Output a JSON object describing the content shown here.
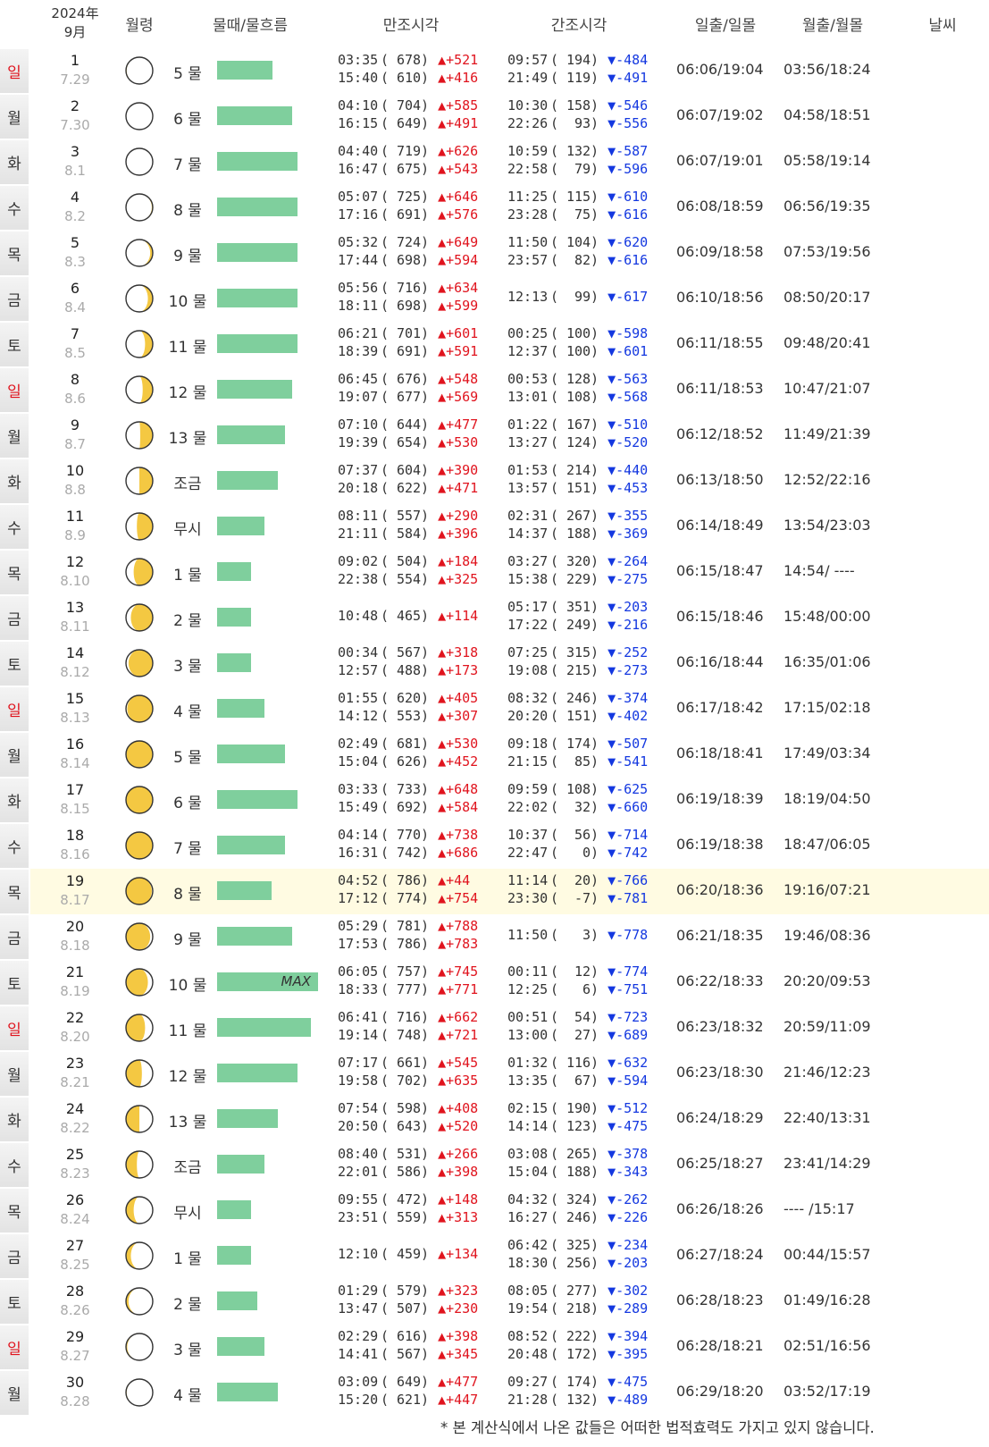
{
  "header": {
    "year": "2024年",
    "month": "9月",
    "moon_age": "월령",
    "mulddae": "물때/물흐름",
    "high_tide": "만조시각",
    "low_tide": "간조시각",
    "sun": "일출/일몰",
    "moon": "월출/월몰",
    "weather": "날씨"
  },
  "max_label": "MAX",
  "footnote": "* 본 계산식에서 나온 값들은 어떠한 법적효력도 가지고 있지 않습니다.",
  "colors": {
    "sunday": "#e0141e",
    "up": "#e0141e",
    "down": "#1438e0",
    "bar": "#7fcf9d",
    "highlight": "#fffbe2",
    "moon_lit": "#f4c842"
  },
  "days": [
    {
      "d": "1",
      "lunar": "7.29",
      "dow": "일",
      "sun_day": true,
      "phase": 0.95,
      "mul": "5 물",
      "flow": 0.55,
      "high": [
        [
          "03:35",
          "678",
          "▲+521"
        ],
        [
          "15:40",
          "610",
          "▲+416"
        ]
      ],
      "low": [
        [
          "09:57",
          "194",
          "▼-484"
        ],
        [
          "21:49",
          "119",
          "▼-491"
        ]
      ],
      "sun": "06:06/19:04",
      "moon": "03:56/18:24"
    },
    {
      "d": "2",
      "lunar": "7.30",
      "dow": "월",
      "phase": 1.0,
      "mul": "6 물",
      "flow": 0.74,
      "high": [
        [
          "04:10",
          "704",
          "▲+585"
        ],
        [
          "16:15",
          "649",
          "▲+491"
        ]
      ],
      "low": [
        [
          "10:30",
          "158",
          "▼-546"
        ],
        [
          "22:26",
          " 93",
          "▼-556"
        ]
      ],
      "sun": "06:07/19:02",
      "moon": "04:58/18:51"
    },
    {
      "d": "3",
      "lunar": "8.1",
      "dow": "화",
      "phase": 0.03,
      "mul": "7 물",
      "flow": 0.8,
      "high": [
        [
          "04:40",
          "719",
          "▲+626"
        ],
        [
          "16:47",
          "675",
          "▲+543"
        ]
      ],
      "low": [
        [
          "10:59",
          "132",
          "▼-587"
        ],
        [
          "22:58",
          " 79",
          "▼-596"
        ]
      ],
      "sun": "06:07/19:01",
      "moon": "05:58/19:14"
    },
    {
      "d": "4",
      "lunar": "8.2",
      "dow": "수",
      "phase": 0.06,
      "mul": "8 물",
      "flow": 0.8,
      "high": [
        [
          "05:07",
          "725",
          "▲+646"
        ],
        [
          "17:16",
          "691",
          "▲+576"
        ]
      ],
      "low": [
        [
          "11:25",
          "115",
          "▼-610"
        ],
        [
          "23:28",
          " 75",
          "▼-616"
        ]
      ],
      "sun": "06:08/18:59",
      "moon": "06:56/19:35"
    },
    {
      "d": "5",
      "lunar": "8.3",
      "dow": "목",
      "phase": 0.1,
      "mul": "9 물",
      "flow": 0.8,
      "high": [
        [
          "05:32",
          "724",
          "▲+649"
        ],
        [
          "17:44",
          "698",
          "▲+594"
        ]
      ],
      "low": [
        [
          "11:50",
          "104",
          "▼-620"
        ],
        [
          "23:57",
          " 82",
          "▼-616"
        ]
      ],
      "sun": "06:09/18:58",
      "moon": "07:53/19:56"
    },
    {
      "d": "6",
      "lunar": "8.4",
      "dow": "금",
      "phase": 0.14,
      "mul": "10 물",
      "flow": 0.8,
      "high": [
        [
          "05:56",
          "716",
          "▲+634"
        ],
        [
          "18:11",
          "698",
          "▲+599"
        ]
      ],
      "low": [
        [
          "12:13",
          " 99",
          "▼-617"
        ]
      ],
      "sun": "06:10/18:56",
      "moon": "08:50/20:17"
    },
    {
      "d": "7",
      "lunar": "8.5",
      "dow": "토",
      "phase": 0.18,
      "mul": "11 물",
      "flow": 0.8,
      "high": [
        [
          "06:21",
          "701",
          "▲+601"
        ],
        [
          "18:39",
          "691",
          "▲+591"
        ]
      ],
      "low": [
        [
          "00:25",
          "100",
          "▼-598"
        ],
        [
          "12:37",
          "100",
          "▼-601"
        ]
      ],
      "sun": "06:11/18:55",
      "moon": "09:48/20:41"
    },
    {
      "d": "8",
      "lunar": "8.6",
      "dow": "일",
      "sun_day": true,
      "phase": 0.21,
      "mul": "12 물",
      "flow": 0.74,
      "high": [
        [
          "06:45",
          "676",
          "▲+548"
        ],
        [
          "19:07",
          "677",
          "▲+569"
        ]
      ],
      "low": [
        [
          "00:53",
          "128",
          "▼-563"
        ],
        [
          "13:01",
          "108",
          "▼-568"
        ]
      ],
      "sun": "06:11/18:53",
      "moon": "10:47/21:07"
    },
    {
      "d": "9",
      "lunar": "8.7",
      "dow": "월",
      "phase": 0.24,
      "mul": "13 물",
      "flow": 0.67,
      "high": [
        [
          "07:10",
          "644",
          "▲+477"
        ],
        [
          "19:39",
          "654",
          "▲+530"
        ]
      ],
      "low": [
        [
          "01:22",
          "167",
          "▼-510"
        ],
        [
          "13:27",
          "124",
          "▼-520"
        ]
      ],
      "sun": "06:12/18:52",
      "moon": "11:49/21:39"
    },
    {
      "d": "10",
      "lunar": "8.8",
      "dow": "화",
      "phase": 0.25,
      "mul": "조금",
      "flow": 0.6,
      "high": [
        [
          "07:37",
          "604",
          "▲+390"
        ],
        [
          "20:18",
          "622",
          "▲+471"
        ]
      ],
      "low": [
        [
          "01:53",
          "214",
          "▼-440"
        ],
        [
          "13:57",
          "151",
          "▼-453"
        ]
      ],
      "sun": "06:13/18:50",
      "moon": "12:52/22:16"
    },
    {
      "d": "11",
      "lunar": "8.9",
      "dow": "수",
      "phase": 0.28,
      "mul": "무시",
      "flow": 0.47,
      "high": [
        [
          "08:11",
          "557",
          "▲+290"
        ],
        [
          "21:11",
          "584",
          "▲+396"
        ]
      ],
      "low": [
        [
          "02:31",
          "267",
          "▼-355"
        ],
        [
          "14:37",
          "188",
          "▼-369"
        ]
      ],
      "sun": "06:14/18:49",
      "moon": "13:54/23:03"
    },
    {
      "d": "12",
      "lunar": "8.10",
      "dow": "목",
      "phase": 0.32,
      "mul": "1 물",
      "flow": 0.34,
      "high": [
        [
          "09:02",
          "504",
          "▲+184"
        ],
        [
          "22:38",
          "554",
          "▲+325"
        ]
      ],
      "low": [
        [
          "03:27",
          "320",
          "▼-264"
        ],
        [
          "15:38",
          "229",
          "▼-275"
        ]
      ],
      "sun": "06:15/18:47",
      "moon": "14:54/ ----"
    },
    {
      "d": "13",
      "lunar": "8.11",
      "dow": "금",
      "phase": 0.36,
      "mul": "2 물",
      "flow": 0.34,
      "high": [
        [
          "10:48",
          "465",
          "▲+114"
        ]
      ],
      "low": [
        [
          "05:17",
          "351",
          "▼-203"
        ],
        [
          "17:22",
          "249",
          "▼-216"
        ]
      ],
      "sun": "06:15/18:46",
      "moon": "15:48/00:00"
    },
    {
      "d": "14",
      "lunar": "8.12",
      "dow": "토",
      "phase": 0.4,
      "mul": "3 물",
      "flow": 0.34,
      "high": [
        [
          "00:34",
          "567",
          "▲+318"
        ],
        [
          "12:57",
          "488",
          "▲+173"
        ]
      ],
      "low": [
        [
          "07:25",
          "315",
          "▼-252"
        ],
        [
          "19:08",
          "215",
          "▼-273"
        ]
      ],
      "sun": "06:16/18:44",
      "moon": "16:35/01:06"
    },
    {
      "d": "15",
      "lunar": "8.13",
      "dow": "일",
      "sun_day": true,
      "phase": 0.43,
      "mul": "4 물",
      "flow": 0.47,
      "high": [
        [
          "01:55",
          "620",
          "▲+405"
        ],
        [
          "14:12",
          "553",
          "▲+307"
        ]
      ],
      "low": [
        [
          "08:32",
          "246",
          "▼-374"
        ],
        [
          "20:20",
          "151",
          "▼-402"
        ]
      ],
      "sun": "06:17/18:42",
      "moon": "17:15/02:18"
    },
    {
      "d": "16",
      "lunar": "8.14",
      "dow": "월",
      "phase": 0.46,
      "mul": "5 물",
      "flow": 0.67,
      "high": [
        [
          "02:49",
          "681",
          "▲+530"
        ],
        [
          "15:04",
          "626",
          "▲+452"
        ]
      ],
      "low": [
        [
          "09:18",
          "174",
          "▼-507"
        ],
        [
          "21:15",
          " 85",
          "▼-541"
        ]
      ],
      "sun": "06:18/18:41",
      "moon": "17:49/03:34"
    },
    {
      "d": "17",
      "lunar": "8.15",
      "dow": "화",
      "phase": 0.5,
      "mul": "6 물",
      "flow": 0.8,
      "high": [
        [
          "03:33",
          "733",
          "▲+648"
        ],
        [
          "15:49",
          "692",
          "▲+584"
        ]
      ],
      "low": [
        [
          "09:59",
          "108",
          "▼-625"
        ],
        [
          "22:02",
          " 32",
          "▼-660"
        ]
      ],
      "sun": "06:19/18:39",
      "moon": "18:19/04:50"
    },
    {
      "d": "18",
      "lunar": "8.16",
      "dow": "수",
      "phase": 0.53,
      "mul": "7 물",
      "flow": 0.67,
      "high": [
        [
          "04:14",
          "770",
          "▲+738"
        ],
        [
          "16:31",
          "742",
          "▲+686"
        ]
      ],
      "low": [
        [
          "10:37",
          " 56",
          "▼-714"
        ],
        [
          "22:47",
          "  0",
          "▼-742"
        ]
      ],
      "sun": "06:19/18:38",
      "moon": "18:47/06:05"
    },
    {
      "d": "19",
      "lunar": "8.17",
      "dow": "목",
      "highlight": true,
      "phase": 0.56,
      "mul": "8 물",
      "flow": 0.54,
      "high": [
        [
          "04:52",
          "786",
          "▲+44"
        ],
        [
          "17:12",
          "774",
          "▲+754"
        ]
      ],
      "low": [
        [
          "11:14",
          " 20",
          "▼-766"
        ],
        [
          "23:30",
          " -7",
          "▼-781"
        ]
      ],
      "sun": "06:20/18:36",
      "moon": "19:16/07:21"
    },
    {
      "d": "20",
      "lunar": "8.18",
      "dow": "금",
      "phase": 0.6,
      "mul": "9 물",
      "flow": 0.74,
      "high": [
        [
          "05:29",
          "781",
          "▲+788"
        ],
        [
          "17:53",
          "786",
          "▲+783"
        ]
      ],
      "low": [
        [
          "11:50",
          "  3",
          "▼-778"
        ]
      ],
      "sun": "06:21/18:35",
      "moon": "19:46/08:36"
    },
    {
      "d": "21",
      "lunar": "8.19",
      "dow": "토",
      "phase": 0.64,
      "mul": "10 물",
      "flow": 1.0,
      "max": true,
      "high": [
        [
          "06:05",
          "757",
          "▲+745"
        ],
        [
          "18:33",
          "777",
          "▲+771"
        ]
      ],
      "low": [
        [
          "00:11",
          " 12",
          "▼-774"
        ],
        [
          "12:25",
          "  6",
          "▼-751"
        ]
      ],
      "sun": "06:22/18:33",
      "moon": "20:20/09:53"
    },
    {
      "d": "22",
      "lunar": "8.20",
      "dow": "일",
      "sun_day": true,
      "phase": 0.68,
      "mul": "11 물",
      "flow": 0.93,
      "high": [
        [
          "06:41",
          "716",
          "▲+662"
        ],
        [
          "19:14",
          "748",
          "▲+721"
        ]
      ],
      "low": [
        [
          "00:51",
          " 54",
          "▼-723"
        ],
        [
          "13:00",
          " 27",
          "▼-689"
        ]
      ],
      "sun": "06:23/18:32",
      "moon": "20:59/11:09"
    },
    {
      "d": "23",
      "lunar": "8.21",
      "dow": "월",
      "phase": 0.72,
      "mul": "12 물",
      "flow": 0.8,
      "high": [
        [
          "07:17",
          "661",
          "▲+545"
        ],
        [
          "19:58",
          "702",
          "▲+635"
        ]
      ],
      "low": [
        [
          "01:32",
          "116",
          "▼-632"
        ],
        [
          "13:35",
          " 67",
          "▼-594"
        ]
      ],
      "sun": "06:23/18:30",
      "moon": "21:46/12:23"
    },
    {
      "d": "24",
      "lunar": "8.22",
      "dow": "화",
      "phase": 0.75,
      "mul": "13 물",
      "flow": 0.6,
      "high": [
        [
          "07:54",
          "598",
          "▲+408"
        ],
        [
          "20:50",
          "643",
          "▲+520"
        ]
      ],
      "low": [
        [
          "02:15",
          "190",
          "▼-512"
        ],
        [
          "14:14",
          "123",
          "▼-475"
        ]
      ],
      "sun": "06:24/18:29",
      "moon": "22:40/13:31"
    },
    {
      "d": "25",
      "lunar": "8.23",
      "dow": "수",
      "phase": 0.78,
      "mul": "조금",
      "flow": 0.47,
      "high": [
        [
          "08:40",
          "531",
          "▲+266"
        ],
        [
          "22:01",
          "586",
          "▲+398"
        ]
      ],
      "low": [
        [
          "03:08",
          "265",
          "▼-378"
        ],
        [
          "15:04",
          "188",
          "▼-343"
        ]
      ],
      "sun": "06:25/18:27",
      "moon": "23:41/14:29"
    },
    {
      "d": "26",
      "lunar": "8.24",
      "dow": "목",
      "phase": 0.82,
      "mul": "무시",
      "flow": 0.34,
      "high": [
        [
          "09:55",
          "472",
          "▲+148"
        ],
        [
          "23:51",
          "559",
          "▲+313"
        ]
      ],
      "low": [
        [
          "04:32",
          "324",
          "▼-262"
        ],
        [
          "16:27",
          "246",
          "▼-226"
        ]
      ],
      "sun": "06:26/18:26",
      "moon": "---- /15:17"
    },
    {
      "d": "27",
      "lunar": "8.25",
      "dow": "금",
      "phase": 0.86,
      "mul": "1 물",
      "flow": 0.34,
      "high": [
        [
          "12:10",
          "459",
          "▲+134"
        ]
      ],
      "low": [
        [
          "06:42",
          "325",
          "▼-234"
        ],
        [
          "18:30",
          "256",
          "▼-203"
        ]
      ],
      "sun": "06:27/18:24",
      "moon": "00:44/15:57"
    },
    {
      "d": "28",
      "lunar": "8.26",
      "dow": "토",
      "phase": 0.9,
      "mul": "2 물",
      "flow": 0.4,
      "high": [
        [
          "01:29",
          "579",
          "▲+323"
        ],
        [
          "13:47",
          "507",
          "▲+230"
        ]
      ],
      "low": [
        [
          "08:05",
          "277",
          "▼-302"
        ],
        [
          "19:54",
          "218",
          "▼-289"
        ]
      ],
      "sun": "06:28/18:23",
      "moon": "01:49/16:28"
    },
    {
      "d": "29",
      "lunar": "8.27",
      "dow": "일",
      "sun_day": true,
      "phase": 0.93,
      "mul": "3 물",
      "flow": 0.47,
      "high": [
        [
          "02:29",
          "616",
          "▲+398"
        ],
        [
          "14:41",
          "567",
          "▲+345"
        ]
      ],
      "low": [
        [
          "08:52",
          "222",
          "▼-394"
        ],
        [
          "20:48",
          "172",
          "▼-395"
        ]
      ],
      "sun": "06:28/18:21",
      "moon": "02:51/16:56"
    },
    {
      "d": "30",
      "lunar": "8.28",
      "dow": "월",
      "phase": 0.95,
      "mul": "4 물",
      "flow": 0.6,
      "high": [
        [
          "03:09",
          "649",
          "▲+477"
        ],
        [
          "15:20",
          "621",
          "▲+447"
        ]
      ],
      "low": [
        [
          "09:27",
          "174",
          "▼-475"
        ],
        [
          "21:28",
          "132",
          "▼-489"
        ]
      ],
      "sun": "06:29/18:20",
      "moon": "03:52/17:19"
    }
  ]
}
